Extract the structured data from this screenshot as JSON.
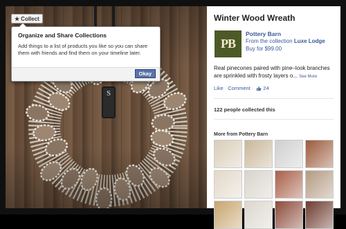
{
  "photo": {
    "monogram_letter": "S",
    "collect_button": {
      "icon": "star-icon",
      "label": "Collect"
    },
    "tooltip": {
      "title": "Organize and Share Collections",
      "body": "Add things to a list of products you like so you can share them with friends and find them on your timeline later.",
      "okay_label": "Okay"
    }
  },
  "product": {
    "title": "Winter Wood Wreath",
    "store": {
      "logo_text": "PB",
      "logo_color": "#4c5a27",
      "name": "Pottery Barn",
      "collection_prefix": "From the collection",
      "collection_name": "Luxe Lodge",
      "price_label": "Buy for $99.00"
    },
    "description": "Real pinecones paired with pine–look branches are sprinkled with frosty layers o...",
    "see_more_label": "See More",
    "actions": {
      "like": "Like",
      "comment": "Comment",
      "separator": "·",
      "like_count": "24"
    },
    "collected_text": "122 people collected this",
    "more_from": {
      "title": "More from Pottery Barn",
      "thumbnails": [
        {
          "subject": "bedding",
          "color": "#d9cdb8"
        },
        {
          "subject": "mug",
          "color": "#c9b79a"
        },
        {
          "subject": "throw-blanket",
          "color": "#cfcfcf"
        },
        {
          "subject": "gift-boxes",
          "color": "#9a5a3a"
        },
        {
          "subject": "kitchen-decor",
          "color": "#e3d8c8"
        },
        {
          "subject": "antler-decor",
          "color": "#d8d3cb"
        },
        {
          "subject": "gift-wrap",
          "color": "#a85f48"
        },
        {
          "subject": "shelf-decor",
          "color": "#b29a82"
        },
        {
          "subject": "candles",
          "color": "#c7a46e"
        },
        {
          "subject": "stockings",
          "color": "#dcd6ce"
        },
        {
          "subject": "ornaments",
          "color": "#8c4a3a"
        },
        {
          "subject": "gift-bags",
          "color": "#6d3b2f"
        }
      ]
    }
  },
  "colors": {
    "link": "#3b5998",
    "button": "#5b74a8"
  }
}
